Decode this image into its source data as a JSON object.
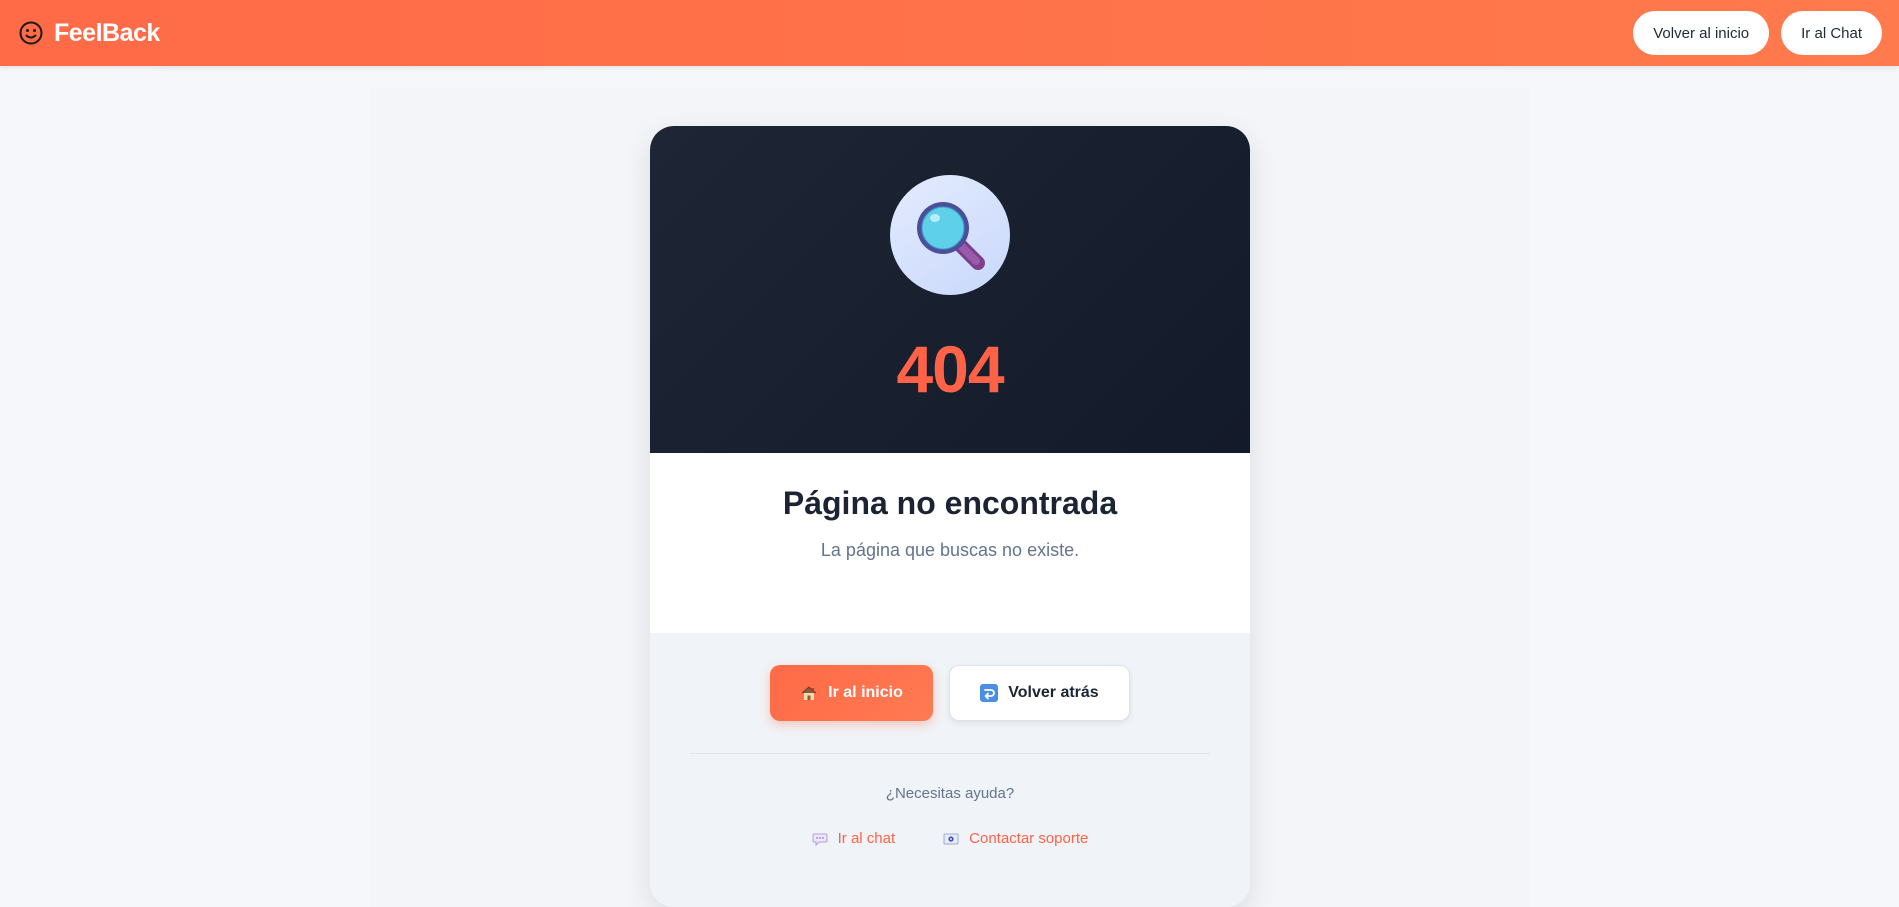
{
  "header": {
    "brand_name": "FeelBack",
    "brand_icon": "smiley-icon",
    "nav": {
      "home_label": "Volver al inicio",
      "chat_label": "Ir al Chat"
    }
  },
  "error": {
    "icon": "magnifying-glass-icon",
    "code": "404",
    "title": "Página no encontrada",
    "message": "La página que buscas no existe."
  },
  "actions": {
    "home_label": "Ir al inicio",
    "home_icon": "house-icon",
    "back_label": "Volver atrás",
    "back_icon": "return-arrow-icon"
  },
  "help": {
    "prompt": "¿Necesitas ayuda?",
    "chat_link": "Ir al chat",
    "chat_icon": "speech-bubble-icon",
    "support_link": "Contactar soporte",
    "support_icon": "envelope-icon"
  },
  "colors": {
    "brand": "#ff6a47",
    "accent": "#ff6347",
    "hero_dark": "#131a2a"
  }
}
